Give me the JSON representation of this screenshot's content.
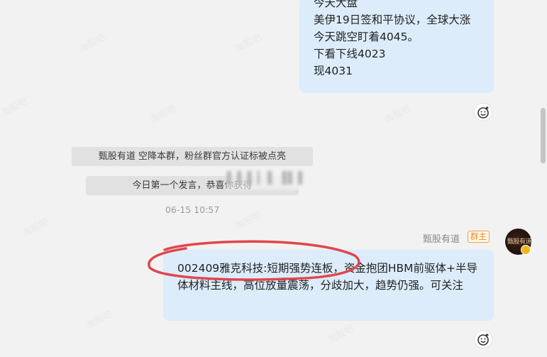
{
  "messages": {
    "top_bubble": {
      "lines": [
        "今天大盘",
        "美伊19日签和平协议，全球大涨",
        "今天跳空盯着4045。",
        "下看下线4023",
        "现4031"
      ]
    },
    "system_notices": [
      "甄股有道 空降本群，粉丝群官方认证标被点亮",
      "今日第一个发言，恭喜你获得"
    ],
    "timestamp": "06-15 10:57",
    "sender": {
      "name": "甄股有道",
      "role_badge": "群主",
      "avatar_text": "甄股有道"
    },
    "bottom_bubble": {
      "text": "002409雅克科技:短期强势连板，资金抱团HBM前驱体+半导体材料主线，高位放量震荡，分歧加大，趋势仍强。可关注"
    }
  },
  "icons": {
    "reaction": "add-emoji-reaction-icon",
    "verified": "verified-badge-icon"
  },
  "colors": {
    "bubble": "#dcecfb",
    "annotation": "#e0474c",
    "badge": "#e8901e"
  },
  "watermark": "淘股吧"
}
